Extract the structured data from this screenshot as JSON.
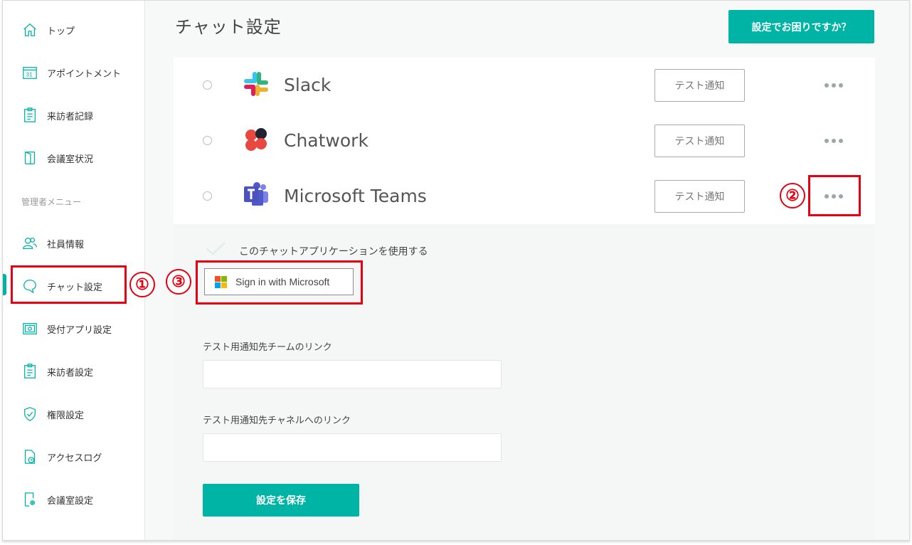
{
  "sidebar": {
    "items": [
      {
        "label": "トップ",
        "icon": "home-icon"
      },
      {
        "label": "アポイントメント",
        "icon": "calendar-icon"
      },
      {
        "label": "来訪者記録",
        "icon": "clipboard-icon"
      },
      {
        "label": "会議室状況",
        "icon": "door-icon"
      }
    ],
    "section_label": "管理者メニュー",
    "admin_items": [
      {
        "label": "社員情報",
        "icon": "users-icon"
      },
      {
        "label": "チャット設定",
        "icon": "chat-bubble-icon",
        "active": true
      },
      {
        "label": "受付アプリ設定",
        "icon": "tablet-gear-icon"
      },
      {
        "label": "来訪者設定",
        "icon": "clipboard-icon"
      },
      {
        "label": "権限設定",
        "icon": "shield-check-icon"
      },
      {
        "label": "アクセスログ",
        "icon": "document-clock-icon"
      },
      {
        "label": "会議室設定",
        "icon": "door-gear-icon"
      }
    ]
  },
  "header": {
    "title": "チャット設定",
    "help_button": "設定でお困りですか？"
  },
  "chat_apps": [
    {
      "name": "Slack",
      "test_button": "テスト通知"
    },
    {
      "name": "Chatwork",
      "test_button": "テスト通知"
    },
    {
      "name": "Microsoft Teams",
      "test_button": "テスト通知"
    }
  ],
  "teams_settings": {
    "use_label": "このチャットアプリケーションを使用する",
    "signin_button": "Sign in with Microsoft",
    "team_link_label": "テスト用通知先チームのリンク",
    "team_link_value": "",
    "channel_link_label": "テスト用通知先チャネルへのリンク",
    "channel_link_value": "",
    "save_button": "設定を保存"
  },
  "annotations": {
    "one": "①",
    "two": "②",
    "three": "③"
  },
  "colors": {
    "accent": "#00b4a5",
    "annotation": "#e60012"
  }
}
